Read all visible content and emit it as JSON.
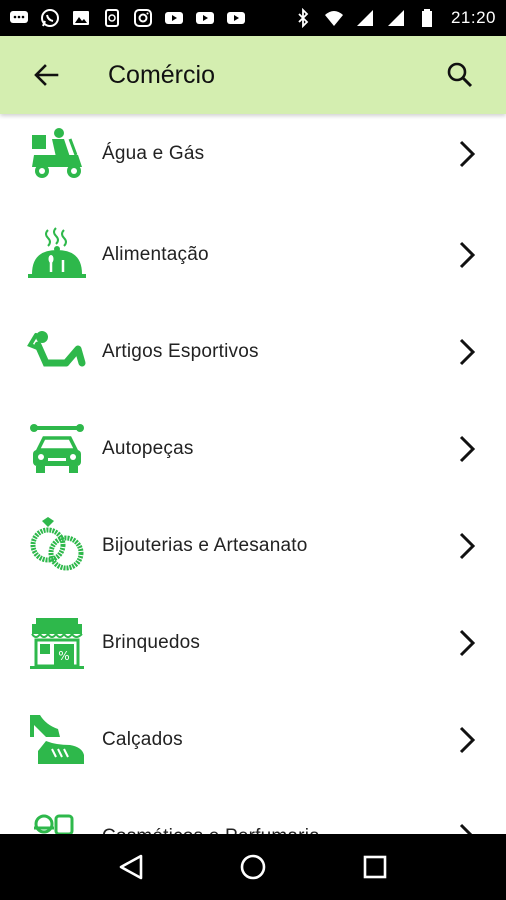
{
  "status_bar": {
    "time": "21:20",
    "left_icons": [
      "chat-icon",
      "whatsapp-icon",
      "image-icon",
      "sync-icon",
      "instagram-icon",
      "youtube-icon",
      "youtube-icon",
      "youtube-icon"
    ],
    "right_icons": [
      "bluetooth-icon",
      "wifi-icon",
      "signal-icon",
      "signal-icon",
      "battery-icon"
    ]
  },
  "app_bar": {
    "title": "Comércio",
    "background": "#d4eeb0"
  },
  "list": {
    "items": [
      {
        "label": "Água e Gás",
        "icon": "delivery-scooter-icon"
      },
      {
        "label": "Alimentação",
        "icon": "food-cloche-icon"
      },
      {
        "label": "Artigos Esportivos",
        "icon": "situp-exercise-icon"
      },
      {
        "label": "Autopeças",
        "icon": "car-wrench-icon"
      },
      {
        "label": "Bijouterias e Artesanato",
        "icon": "rings-icon"
      },
      {
        "label": "Brinquedos",
        "icon": "toy-store-icon"
      },
      {
        "label": "Calçados",
        "icon": "shoes-icon"
      },
      {
        "label": "Cosméticos e Perfumaria",
        "icon": "cosmetics-icon"
      }
    ]
  },
  "colors": {
    "accent_green": "#2eb84b",
    "text": "#222222",
    "status_bar": "#000000",
    "nav_bar": "#000000"
  },
  "nav_bar": {
    "buttons": [
      "back-triangle-icon",
      "home-circle-icon",
      "recents-square-icon"
    ]
  }
}
